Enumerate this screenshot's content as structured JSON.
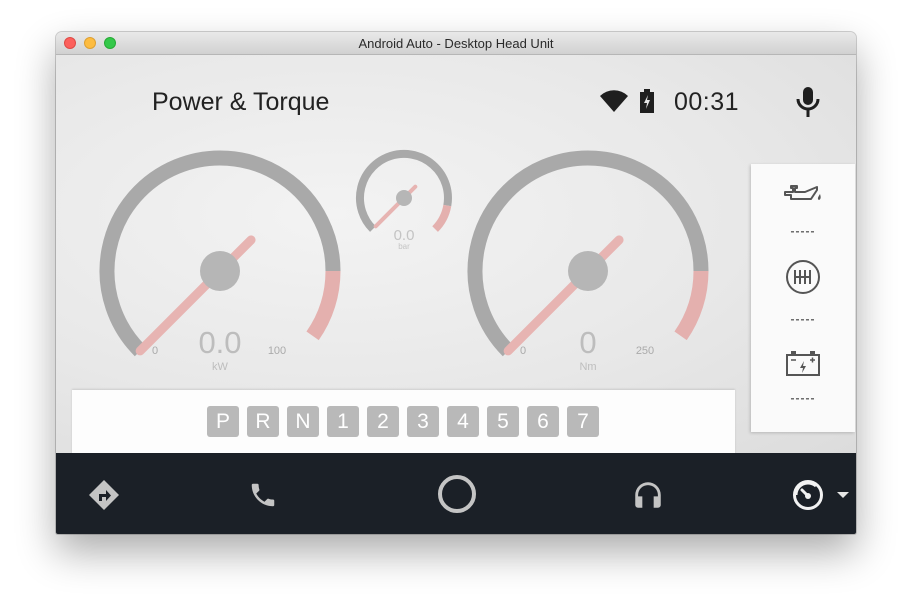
{
  "window": {
    "title": "Android Auto - Desktop Head Unit"
  },
  "header": {
    "title": "Power & Torque",
    "clock": "00:31"
  },
  "icons": {
    "wifi": "wifi-icon",
    "battery": "battery-charging-icon",
    "mic": "microphone-icon",
    "oil": "oil-can-icon",
    "transmission": "transmission-icon",
    "car_battery": "car-battery-icon",
    "nav": [
      "directions-icon",
      "phone-icon",
      "home-circle-icon",
      "headphones-icon",
      "dashboard-gauge-icon",
      "dropdown-arrow-icon"
    ]
  },
  "gauges": {
    "power": {
      "value": "0.0",
      "unit": "kW",
      "min_label": "0",
      "max_label": "100",
      "needle_fraction": 0.0
    },
    "boost": {
      "value": "0.0",
      "unit": "bar",
      "needle_fraction": 0.0
    },
    "torque": {
      "value": "0",
      "unit": "Nm",
      "min_label": "0",
      "max_label": "250",
      "needle_fraction": 0.0
    }
  },
  "side_panel": {
    "oil_value": "-----",
    "transmission_value": "-----",
    "battery_value": "-----"
  },
  "gears": [
    "P",
    "R",
    "N",
    "1",
    "2",
    "3",
    "4",
    "5",
    "6",
    "7"
  ],
  "colors": {
    "gauge_arc": "#a9a9a9",
    "redline": "#e4b0ae",
    "needle": "#e7b4b2",
    "hub": "#b6b6b6",
    "navbar": "#1b2027",
    "nav_icon": "#c4c4c4",
    "gear_box": "#b9b9b9"
  }
}
